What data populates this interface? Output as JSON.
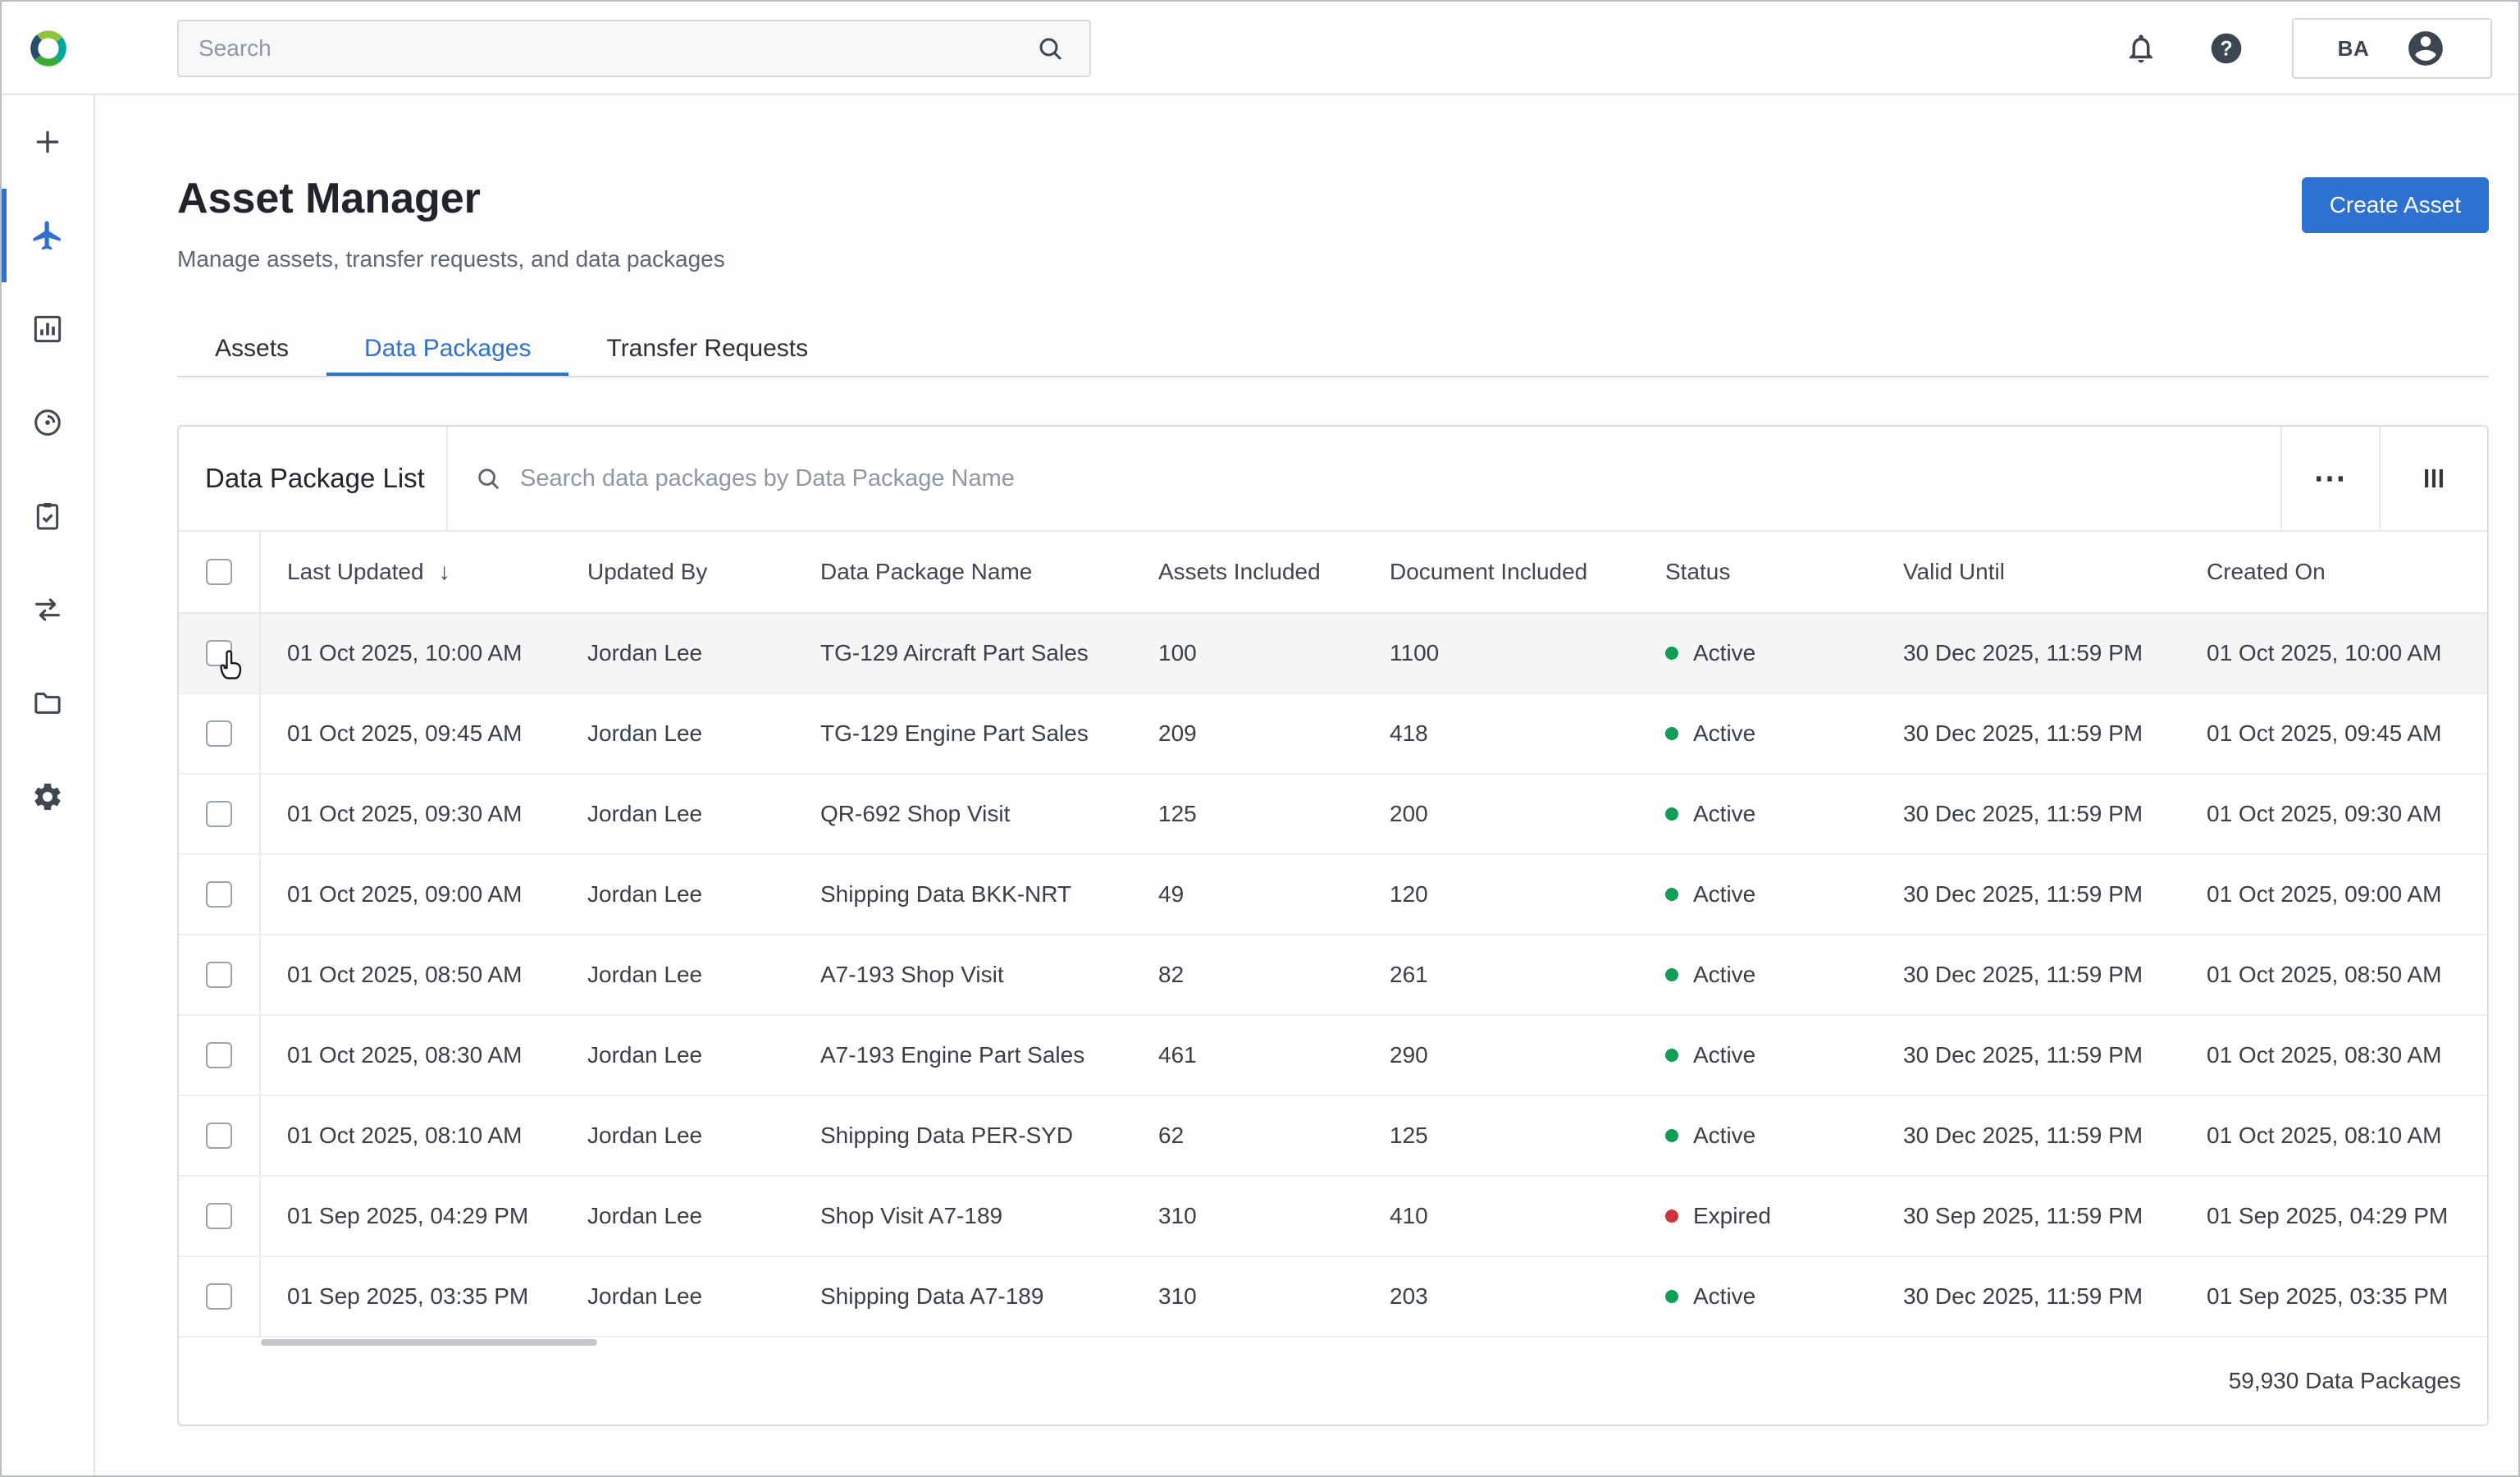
{
  "topbar": {
    "search": {
      "placeholder": "Search"
    },
    "user": {
      "initials": "BA"
    }
  },
  "icons": {
    "sort_desc": "↓",
    "more_options": "⋯",
    "search": "magnifier",
    "notifications": "bell",
    "help": "question-circle",
    "user": "person-circle",
    "columns": "vertical-bars"
  },
  "sidebar": {
    "items": [
      {
        "id": "new",
        "icon": "plus-icon",
        "active": false
      },
      {
        "id": "assets",
        "icon": "airplane-icon",
        "active": true
      },
      {
        "id": "analytics",
        "icon": "bar-chart-icon",
        "active": false
      },
      {
        "id": "tracking",
        "icon": "radar-icon",
        "active": false
      },
      {
        "id": "tasks",
        "icon": "clipboard-check-icon",
        "active": false
      },
      {
        "id": "transfers",
        "icon": "transfer-arrows-icon",
        "active": false
      },
      {
        "id": "files",
        "icon": "folder-icon",
        "active": false
      },
      {
        "id": "settings",
        "icon": "gear-icon",
        "active": false
      }
    ]
  },
  "page": {
    "title": "Asset Manager",
    "subtitle": "Manage assets, transfer requests, and data packages",
    "create_button_label": "Create Asset",
    "tabs": [
      {
        "label": "Assets",
        "active": false
      },
      {
        "label": "Data Packages",
        "active": true
      },
      {
        "label": "Transfer Requests",
        "active": false
      }
    ]
  },
  "panel": {
    "title": "Data Package List",
    "search_placeholder": "Search data packages by Data Package Name",
    "footer_count": "59,930 Data Packages"
  },
  "table": {
    "columns": [
      {
        "key": "last_updated",
        "label": "Last Updated",
        "sorted": "desc"
      },
      {
        "key": "updated_by",
        "label": "Updated By"
      },
      {
        "key": "name",
        "label": "Data Package Name"
      },
      {
        "key": "assets",
        "label": "Assets Included"
      },
      {
        "key": "documents",
        "label": "Document Included"
      },
      {
        "key": "status",
        "label": "Status"
      },
      {
        "key": "valid_until",
        "label": "Valid Until"
      },
      {
        "key": "created_on",
        "label": "Created On"
      }
    ],
    "status_colors": {
      "Active": "#0f9d58",
      "Expired": "#d13438"
    },
    "rows": [
      {
        "last_updated": "01 Oct 2025, 10:00 AM",
        "updated_by": "Jordan Lee",
        "name": "TG-129 Aircraft Part Sales",
        "assets": 100,
        "documents": 1100,
        "status": "Active",
        "valid_until": "30 Dec 2025, 11:59 PM",
        "created_on": "01 Oct 2025, 10:00 AM",
        "hovered": true
      },
      {
        "last_updated": "01 Oct 2025, 09:45 AM",
        "updated_by": "Jordan Lee",
        "name": "TG-129 Engine Part Sales",
        "assets": 209,
        "documents": 418,
        "status": "Active",
        "valid_until": "30 Dec 2025, 11:59 PM",
        "created_on": "01 Oct 2025, 09:45 AM"
      },
      {
        "last_updated": "01 Oct 2025, 09:30 AM",
        "updated_by": "Jordan Lee",
        "name": "QR-692 Shop Visit",
        "assets": 125,
        "documents": 200,
        "status": "Active",
        "valid_until": "30 Dec 2025, 11:59 PM",
        "created_on": "01 Oct 2025, 09:30 AM"
      },
      {
        "last_updated": "01 Oct 2025, 09:00 AM",
        "updated_by": "Jordan Lee",
        "name": "Shipping Data BKK-NRT",
        "assets": 49,
        "documents": 120,
        "status": "Active",
        "valid_until": "30 Dec 2025, 11:59 PM",
        "created_on": "01 Oct 2025, 09:00 AM"
      },
      {
        "last_updated": "01 Oct 2025, 08:50 AM",
        "updated_by": "Jordan Lee",
        "name": "A7-193 Shop Visit",
        "assets": 82,
        "documents": 261,
        "status": "Active",
        "valid_until": "30 Dec 2025, 11:59 PM",
        "created_on": "01 Oct 2025, 08:50 AM"
      },
      {
        "last_updated": "01 Oct 2025, 08:30 AM",
        "updated_by": "Jordan Lee",
        "name": "A7-193 Engine Part Sales",
        "assets": 461,
        "documents": 290,
        "status": "Active",
        "valid_until": "30 Dec 2025, 11:59 PM",
        "created_on": "01 Oct 2025, 08:30 AM"
      },
      {
        "last_updated": "01 Oct 2025, 08:10 AM",
        "updated_by": "Jordan Lee",
        "name": "Shipping Data PER-SYD",
        "assets": 62,
        "documents": 125,
        "status": "Active",
        "valid_until": "30 Dec 2025, 11:59 PM",
        "created_on": "01 Oct 2025, 08:10 AM"
      },
      {
        "last_updated": "01 Sep 2025, 04:29 PM",
        "updated_by": "Jordan Lee",
        "name": "Shop Visit A7-189",
        "assets": 310,
        "documents": 410,
        "status": "Expired",
        "valid_until": "30 Sep 2025, 11:59 PM",
        "created_on": "01 Sep 2025, 04:29 PM"
      },
      {
        "last_updated": "01 Sep 2025, 03:35 PM",
        "updated_by": "Jordan Lee",
        "name": "Shipping Data A7-189",
        "assets": 310,
        "documents": 203,
        "status": "Active",
        "valid_until": "30 Dec 2025, 11:59 PM",
        "created_on": "01 Sep 2025, 03:35 PM"
      }
    ]
  }
}
